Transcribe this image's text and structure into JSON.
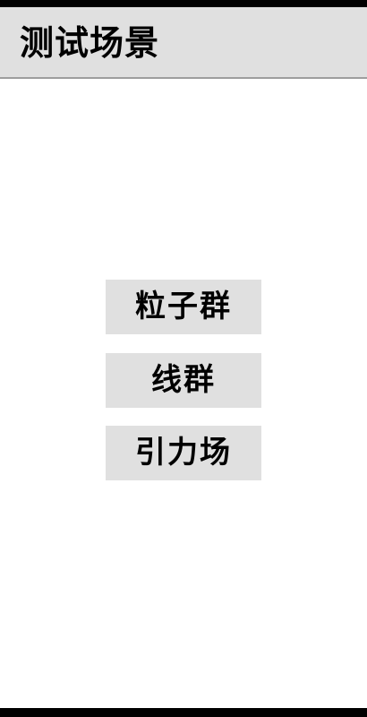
{
  "app_bar": {
    "title": "测试场景"
  },
  "menu": {
    "buttons": [
      {
        "label": "粒子群"
      },
      {
        "label": "线群"
      },
      {
        "label": "引力场"
      }
    ]
  },
  "colors": {
    "app_bar_background": "#e0e0e0",
    "app_bar_divider": "#9e9e9e",
    "button_background": "#e0e0e0",
    "text": "#000000",
    "page_background": "#ffffff",
    "system_bars": "#000000"
  }
}
